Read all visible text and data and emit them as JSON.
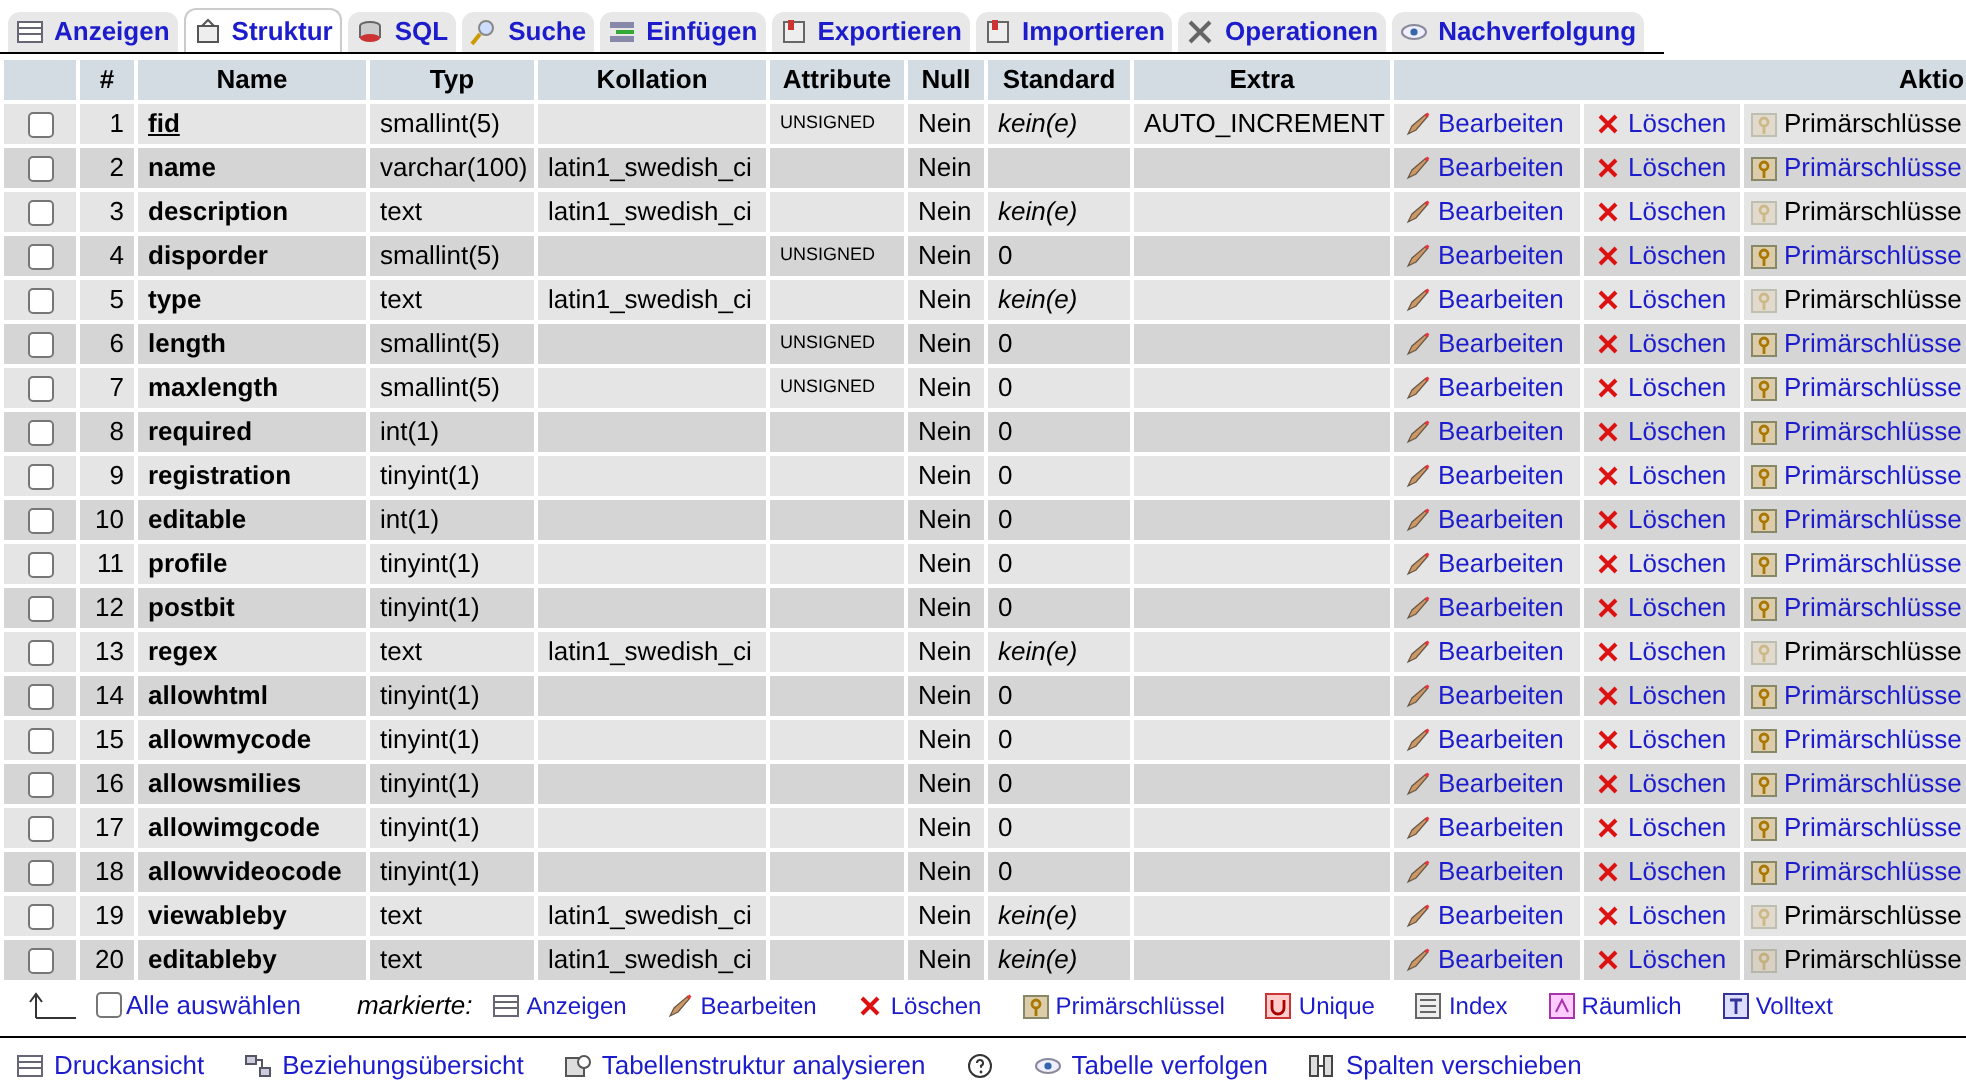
{
  "tabs": [
    {
      "label": "Anzeigen",
      "kind": "browse",
      "selected": false
    },
    {
      "label": "Struktur",
      "kind": "structure",
      "selected": true
    },
    {
      "label": "SQL",
      "kind": "sql",
      "selected": false
    },
    {
      "label": "Suche",
      "kind": "search",
      "selected": false
    },
    {
      "label": "Einfügen",
      "kind": "insert",
      "selected": false
    },
    {
      "label": "Exportieren",
      "kind": "export",
      "selected": false
    },
    {
      "label": "Importieren",
      "kind": "import",
      "selected": false
    },
    {
      "label": "Operationen",
      "kind": "operations",
      "selected": false
    },
    {
      "label": "Nachverfolgung",
      "kind": "tracking",
      "selected": false
    }
  ],
  "table": {
    "columns": [
      "#",
      "Name",
      "Typ",
      "Kollation",
      "Attribute",
      "Null",
      "Standard",
      "Extra",
      "Aktio"
    ],
    "rows": [
      {
        "checked": false,
        "index": "1",
        "name": "fid",
        "primary": true,
        "type": "smallint(5)",
        "collation": "",
        "attribute": "UNSIGNED",
        "null": "Nein",
        "standard": "kein(e)",
        "standard_none": true,
        "extra": "AUTO_INCREMENT",
        "edit": "Bearbeiten",
        "delete": "Löschen",
        "primary_key": "Primärschlüsse",
        "primary_enabled": false
      },
      {
        "checked": false,
        "index": "2",
        "name": "name",
        "primary": false,
        "type": "varchar(100)",
        "collation": "latin1_swedish_ci",
        "attribute": "",
        "null": "Nein",
        "standard": "",
        "standard_none": false,
        "extra": "",
        "edit": "Bearbeiten",
        "delete": "Löschen",
        "primary_key": "Primärschlüsse",
        "primary_enabled": true
      },
      {
        "checked": false,
        "index": "3",
        "name": "description",
        "primary": false,
        "type": "text",
        "collation": "latin1_swedish_ci",
        "attribute": "",
        "null": "Nein",
        "standard": "kein(e)",
        "standard_none": true,
        "extra": "",
        "edit": "Bearbeiten",
        "delete": "Löschen",
        "primary_key": "Primärschlüsse",
        "primary_enabled": false
      },
      {
        "checked": false,
        "index": "4",
        "name": "disporder",
        "primary": false,
        "type": "smallint(5)",
        "collation": "",
        "attribute": "UNSIGNED",
        "null": "Nein",
        "standard": "0",
        "standard_none": false,
        "extra": "",
        "edit": "Bearbeiten",
        "delete": "Löschen",
        "primary_key": "Primärschlüsse",
        "primary_enabled": true
      },
      {
        "checked": false,
        "index": "5",
        "name": "type",
        "primary": false,
        "type": "text",
        "collation": "latin1_swedish_ci",
        "attribute": "",
        "null": "Nein",
        "standard": "kein(e)",
        "standard_none": true,
        "extra": "",
        "edit": "Bearbeiten",
        "delete": "Löschen",
        "primary_key": "Primärschlüsse",
        "primary_enabled": false
      },
      {
        "checked": false,
        "index": "6",
        "name": "length",
        "primary": false,
        "type": "smallint(5)",
        "collation": "",
        "attribute": "UNSIGNED",
        "null": "Nein",
        "standard": "0",
        "standard_none": false,
        "extra": "",
        "edit": "Bearbeiten",
        "delete": "Löschen",
        "primary_key": "Primärschlüsse",
        "primary_enabled": true
      },
      {
        "checked": false,
        "index": "7",
        "name": "maxlength",
        "primary": false,
        "type": "smallint(5)",
        "collation": "",
        "attribute": "UNSIGNED",
        "null": "Nein",
        "standard": "0",
        "standard_none": false,
        "extra": "",
        "edit": "Bearbeiten",
        "delete": "Löschen",
        "primary_key": "Primärschlüsse",
        "primary_enabled": true
      },
      {
        "checked": false,
        "index": "8",
        "name": "required",
        "primary": false,
        "type": "int(1)",
        "collation": "",
        "attribute": "",
        "null": "Nein",
        "standard": "0",
        "standard_none": false,
        "extra": "",
        "edit": "Bearbeiten",
        "delete": "Löschen",
        "primary_key": "Primärschlüsse",
        "primary_enabled": true
      },
      {
        "checked": false,
        "index": "9",
        "name": "registration",
        "primary": false,
        "type": "tinyint(1)",
        "collation": "",
        "attribute": "",
        "null": "Nein",
        "standard": "0",
        "standard_none": false,
        "extra": "",
        "edit": "Bearbeiten",
        "delete": "Löschen",
        "primary_key": "Primärschlüsse",
        "primary_enabled": true
      },
      {
        "checked": false,
        "index": "10",
        "name": "editable",
        "primary": false,
        "type": "int(1)",
        "collation": "",
        "attribute": "",
        "null": "Nein",
        "standard": "0",
        "standard_none": false,
        "extra": "",
        "edit": "Bearbeiten",
        "delete": "Löschen",
        "primary_key": "Primärschlüsse",
        "primary_enabled": true
      },
      {
        "checked": false,
        "index": "11",
        "name": "profile",
        "primary": false,
        "type": "tinyint(1)",
        "collation": "",
        "attribute": "",
        "null": "Nein",
        "standard": "0",
        "standard_none": false,
        "extra": "",
        "edit": "Bearbeiten",
        "delete": "Löschen",
        "primary_key": "Primärschlüsse",
        "primary_enabled": true
      },
      {
        "checked": false,
        "index": "12",
        "name": "postbit",
        "primary": false,
        "type": "tinyint(1)",
        "collation": "",
        "attribute": "",
        "null": "Nein",
        "standard": "0",
        "standard_none": false,
        "extra": "",
        "edit": "Bearbeiten",
        "delete": "Löschen",
        "primary_key": "Primärschlüsse",
        "primary_enabled": true
      },
      {
        "checked": false,
        "index": "13",
        "name": "regex",
        "primary": false,
        "type": "text",
        "collation": "latin1_swedish_ci",
        "attribute": "",
        "null": "Nein",
        "standard": "kein(e)",
        "standard_none": true,
        "extra": "",
        "edit": "Bearbeiten",
        "delete": "Löschen",
        "primary_key": "Primärschlüsse",
        "primary_enabled": false
      },
      {
        "checked": false,
        "index": "14",
        "name": "allowhtml",
        "primary": false,
        "type": "tinyint(1)",
        "collation": "",
        "attribute": "",
        "null": "Nein",
        "standard": "0",
        "standard_none": false,
        "extra": "",
        "edit": "Bearbeiten",
        "delete": "Löschen",
        "primary_key": "Primärschlüsse",
        "primary_enabled": true
      },
      {
        "checked": false,
        "index": "15",
        "name": "allowmycode",
        "primary": false,
        "type": "tinyint(1)",
        "collation": "",
        "attribute": "",
        "null": "Nein",
        "standard": "0",
        "standard_none": false,
        "extra": "",
        "edit": "Bearbeiten",
        "delete": "Löschen",
        "primary_key": "Primärschlüsse",
        "primary_enabled": true
      },
      {
        "checked": false,
        "index": "16",
        "name": "allowsmilies",
        "primary": false,
        "type": "tinyint(1)",
        "collation": "",
        "attribute": "",
        "null": "Nein",
        "standard": "0",
        "standard_none": false,
        "extra": "",
        "edit": "Bearbeiten",
        "delete": "Löschen",
        "primary_key": "Primärschlüsse",
        "primary_enabled": true
      },
      {
        "checked": false,
        "index": "17",
        "name": "allowimgcode",
        "primary": false,
        "type": "tinyint(1)",
        "collation": "",
        "attribute": "",
        "null": "Nein",
        "standard": "0",
        "standard_none": false,
        "extra": "",
        "edit": "Bearbeiten",
        "delete": "Löschen",
        "primary_key": "Primärschlüsse",
        "primary_enabled": true
      },
      {
        "checked": false,
        "index": "18",
        "name": "allowvideocode",
        "primary": false,
        "type": "tinyint(1)",
        "collation": "",
        "attribute": "",
        "null": "Nein",
        "standard": "0",
        "standard_none": false,
        "extra": "",
        "edit": "Bearbeiten",
        "delete": "Löschen",
        "primary_key": "Primärschlüsse",
        "primary_enabled": true
      },
      {
        "checked": false,
        "index": "19",
        "name": "viewableby",
        "primary": false,
        "type": "text",
        "collation": "latin1_swedish_ci",
        "attribute": "",
        "null": "Nein",
        "standard": "kein(e)",
        "standard_none": true,
        "extra": "",
        "edit": "Bearbeiten",
        "delete": "Löschen",
        "primary_key": "Primärschlüsse",
        "primary_enabled": false
      },
      {
        "checked": false,
        "index": "20",
        "name": "editableby",
        "primary": false,
        "type": "text",
        "collation": "latin1_swedish_ci",
        "attribute": "",
        "null": "Nein",
        "standard": "kein(e)",
        "standard_none": true,
        "extra": "",
        "edit": "Bearbeiten",
        "delete": "Löschen",
        "primary_key": "Primärschlüsse",
        "primary_enabled": false
      }
    ]
  },
  "selection_bar": {
    "select_all": {
      "label": "Alle auswählen",
      "checked": false
    },
    "with_selected": "markierte:",
    "actions": [
      {
        "label": "Anzeigen",
        "kind": "browse"
      },
      {
        "label": "Bearbeiten",
        "kind": "edit"
      },
      {
        "label": "Löschen",
        "kind": "delete"
      },
      {
        "label": "Primärschlüssel",
        "kind": "primary"
      },
      {
        "label": "Unique",
        "kind": "unique"
      },
      {
        "label": "Index",
        "kind": "index"
      },
      {
        "label": "Räumlich",
        "kind": "spatial"
      },
      {
        "label": "Volltext",
        "kind": "fulltext"
      }
    ]
  },
  "footer_links": [
    {
      "label": "Druckansicht",
      "kind": "print"
    },
    {
      "label": "Beziehungsübersicht",
      "kind": "relations"
    },
    {
      "label": "Tabellenstruktur analysieren",
      "kind": "analyze"
    },
    {
      "kind": "help"
    },
    {
      "label": "Tabelle verfolgen",
      "kind": "track"
    },
    {
      "label": "Spalten verschieben",
      "kind": "move"
    }
  ]
}
